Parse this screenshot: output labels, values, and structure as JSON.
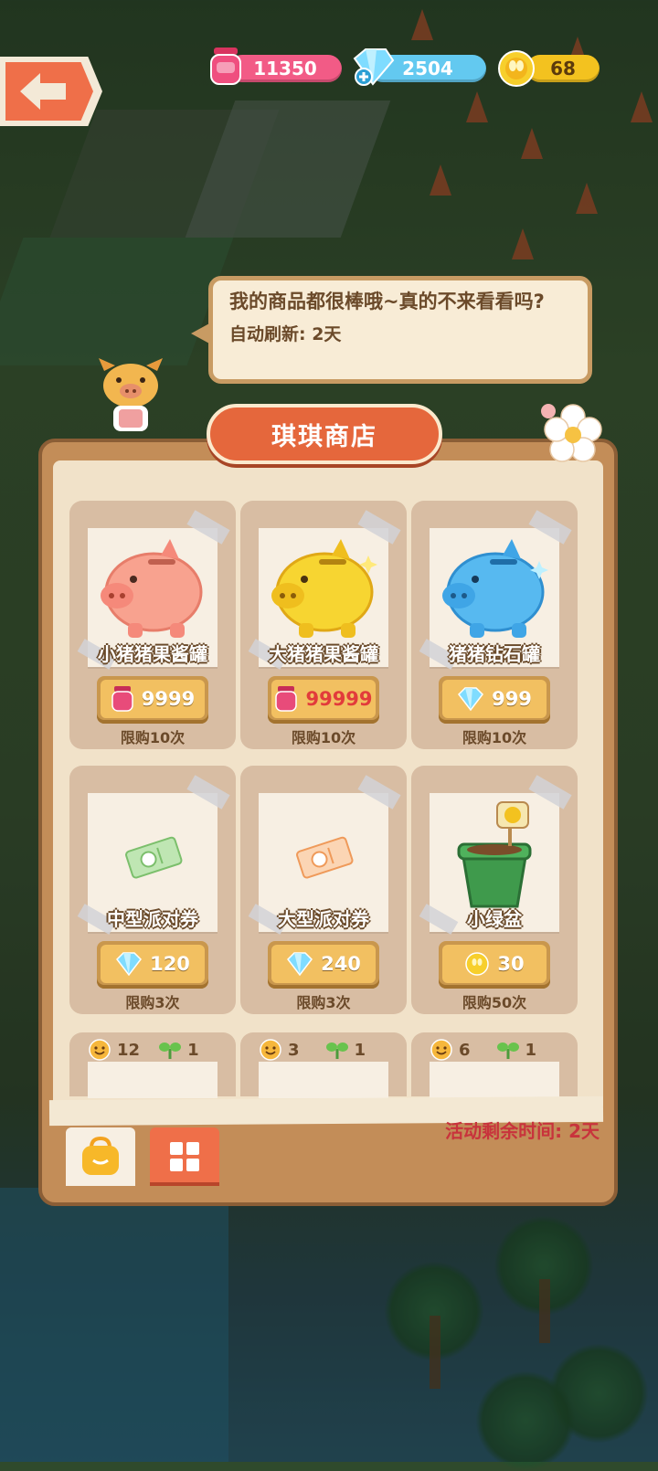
{
  "header": {
    "resources": [
      {
        "name": "jam",
        "icon": "jam-jar-icon",
        "value": "11350"
      },
      {
        "name": "gem",
        "icon": "diamond-plus-icon",
        "value": "2504"
      },
      {
        "name": "coin",
        "icon": "coin-icon",
        "value": "68"
      }
    ]
  },
  "dialog": {
    "message": "我的商品都很棒哦~真的不来看看吗?",
    "refresh": "自动刷新: 2天"
  },
  "shop": {
    "title": "琪琪商店",
    "items": [
      {
        "name": "小猪猪果酱罐",
        "icon": "pink-piggy-bank-icon",
        "currency_icon": "jam-jar-icon",
        "price": "9999",
        "price_affordable": true,
        "limit": "限购10次"
      },
      {
        "name": "大猪猪果酱罐",
        "icon": "gold-piggy-bank-icon",
        "currency_icon": "jam-jar-icon",
        "price": "99999",
        "price_affordable": false,
        "limit": "限购10次"
      },
      {
        "name": "猪猪钻石罐",
        "icon": "blue-piggy-bank-icon",
        "currency_icon": "diamond-icon",
        "price": "999",
        "price_affordable": true,
        "limit": "限购10次"
      },
      {
        "name": "中型派对券",
        "icon": "green-ticket-icon",
        "currency_icon": "diamond-icon",
        "price": "120",
        "price_affordable": true,
        "limit": "限购3次"
      },
      {
        "name": "大型派对券",
        "icon": "orange-ticket-icon",
        "currency_icon": "diamond-icon",
        "price": "240",
        "price_affordable": true,
        "limit": "限购3次"
      },
      {
        "name": "小绿盆",
        "icon": "green-pot-icon",
        "currency_icon": "coin-icon",
        "price": "30",
        "price_affordable": true,
        "limit": "限购50次"
      }
    ],
    "partial_items": [
      {
        "smile": "12",
        "sprout": "1"
      },
      {
        "smile": "3",
        "sprout": "1"
      },
      {
        "smile": "6",
        "sprout": "1"
      }
    ],
    "timer": "活动剩余时间: 2天",
    "tabs": [
      {
        "icon": "shopping-bag-icon",
        "active": true
      },
      {
        "icon": "grid-icon",
        "active": false
      }
    ]
  }
}
